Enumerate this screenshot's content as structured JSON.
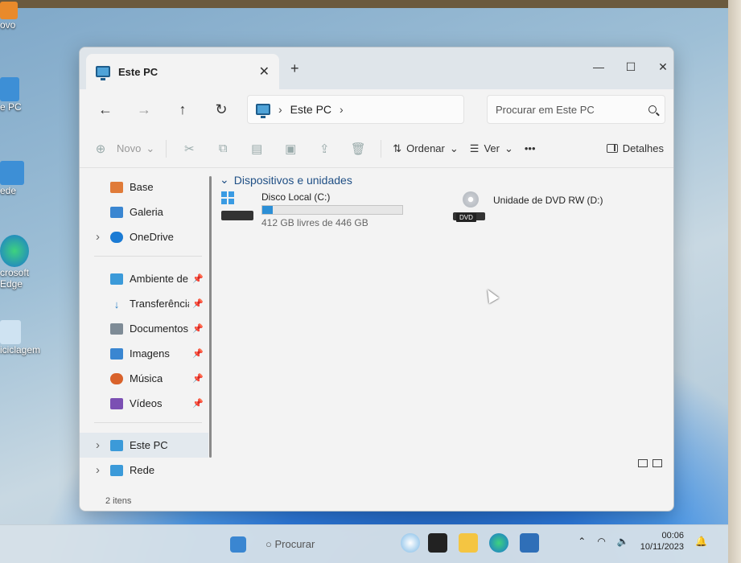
{
  "desktop": {
    "icons": [
      {
        "label": "ovo"
      },
      {
        "label": "e PC"
      },
      {
        "label": "ede"
      },
      {
        "label": "crosoft\nEdge"
      },
      {
        "label": "iciclagem"
      }
    ]
  },
  "window": {
    "tab_title": "Este PC",
    "new_tab": "+",
    "close_tab": "✕",
    "controls": {
      "minimize": "—",
      "maximize": "☐",
      "close": "✕"
    }
  },
  "nav": {
    "back": "←",
    "forward": "→",
    "up": "↑",
    "refresh": "↻",
    "breadcrumb": "Este PC",
    "search_placeholder": "Procurar em Este PC"
  },
  "toolbar": {
    "new_label": "Novo",
    "sort_label": "Ordenar",
    "view_label": "Ver",
    "more_label": "•••",
    "details_label": "Detalhes"
  },
  "sidebar": {
    "items": [
      {
        "label": "Base"
      },
      {
        "label": "Galeria"
      },
      {
        "label": "OneDrive"
      },
      {
        "label": "Ambiente de"
      },
      {
        "label": "Transferência"
      },
      {
        "label": "Documentos"
      },
      {
        "label": "Imagens"
      },
      {
        "label": "Música"
      },
      {
        "label": "Vídeos"
      },
      {
        "label": "Este PC"
      },
      {
        "label": "Rede"
      }
    ]
  },
  "content": {
    "group_title": "Dispositivos e unidades",
    "drives": [
      {
        "name": "Disco Local (C:)",
        "free": "412 GB livres de 446 GB",
        "used_fraction": 0.076
      },
      {
        "name": "Unidade de DVD RW (D:)",
        "badge": "DVD"
      }
    ]
  },
  "status": {
    "items_count": "2 itens"
  },
  "taskbar": {
    "search_label": "Procurar",
    "time": "00:06",
    "date": "10/11/2023"
  }
}
